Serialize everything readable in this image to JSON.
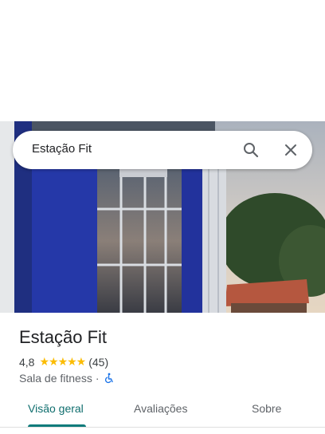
{
  "search": {
    "value": "Estação Fit"
  },
  "place": {
    "name": "Estação Fit",
    "rating": "4,8",
    "stars": "★★★★★",
    "review_count": "(45)",
    "category": "Sala de fitness",
    "separator": "·"
  },
  "tabs": [
    {
      "label": "Visão geral",
      "active": true
    },
    {
      "label": "Avaliações",
      "active": false
    },
    {
      "label": "Sobre",
      "active": false
    }
  ],
  "colors": {
    "accent": "#0f7b7b",
    "stars": "#fbbc04",
    "wheelchair_icon": "#1a73e8"
  }
}
